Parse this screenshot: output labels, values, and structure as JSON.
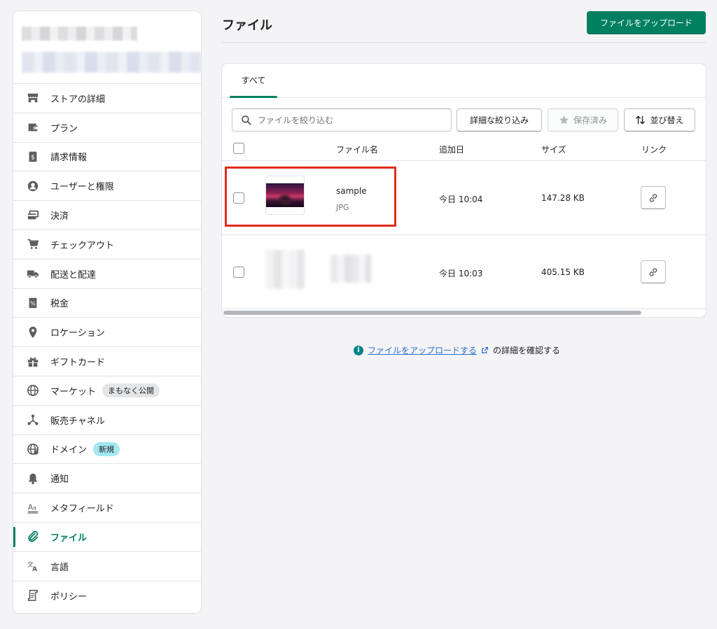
{
  "sidebar": {
    "items": [
      {
        "label": "ストアの詳細",
        "icon": "store-icon"
      },
      {
        "label": "プラン",
        "icon": "wallet-icon"
      },
      {
        "label": "請求情報",
        "icon": "billing-icon"
      },
      {
        "label": "ユーザーと権限",
        "icon": "user-icon"
      },
      {
        "label": "決済",
        "icon": "payment-icon"
      },
      {
        "label": "チェックアウト",
        "icon": "cart-icon"
      },
      {
        "label": "配送と配達",
        "icon": "truck-icon"
      },
      {
        "label": "税金",
        "icon": "tax-icon"
      },
      {
        "label": "ロケーション",
        "icon": "location-pin-icon"
      },
      {
        "label": "ギフトカード",
        "icon": "gift-icon"
      },
      {
        "label": "マーケット",
        "icon": "globe-icon",
        "badge": "まもなく公開"
      },
      {
        "label": "販売チャネル",
        "icon": "channels-icon"
      },
      {
        "label": "ドメイン",
        "icon": "domain-globe-icon",
        "badge": "新規"
      },
      {
        "label": "通知",
        "icon": "bell-icon"
      },
      {
        "label": "メタフィールド",
        "icon": "metafield-icon"
      },
      {
        "label": "ファイル",
        "icon": "paperclip-icon",
        "active": true
      },
      {
        "label": "言語",
        "icon": "translate-icon"
      },
      {
        "label": "ポリシー",
        "icon": "policy-icon"
      }
    ]
  },
  "header": {
    "title": "ファイル",
    "upload_button": "ファイルをアップロード"
  },
  "tabs": [
    {
      "label": "すべて",
      "active": true
    }
  ],
  "toolbar": {
    "search_placeholder": "ファイルを絞り込む",
    "filter_button": "詳細な絞り込み",
    "saved_button": "保存済み",
    "sort_button": "並び替え"
  },
  "table": {
    "columns": [
      "ファイル名",
      "追加日",
      "サイズ",
      "リンク"
    ],
    "rows": [
      {
        "name": "sample",
        "type": "JPG",
        "added": "今日 10:04",
        "size": "147.28 KB"
      },
      {
        "name": "",
        "type": "",
        "added": "今日 10:03",
        "size": "405.15 KB"
      }
    ]
  },
  "footer": {
    "link_text": "ファイルをアップロードする",
    "suffix": "の詳細を確認する"
  },
  "colors": {
    "accent": "#008060",
    "highlight": "#e02d18",
    "link": "#2c6ecb"
  }
}
